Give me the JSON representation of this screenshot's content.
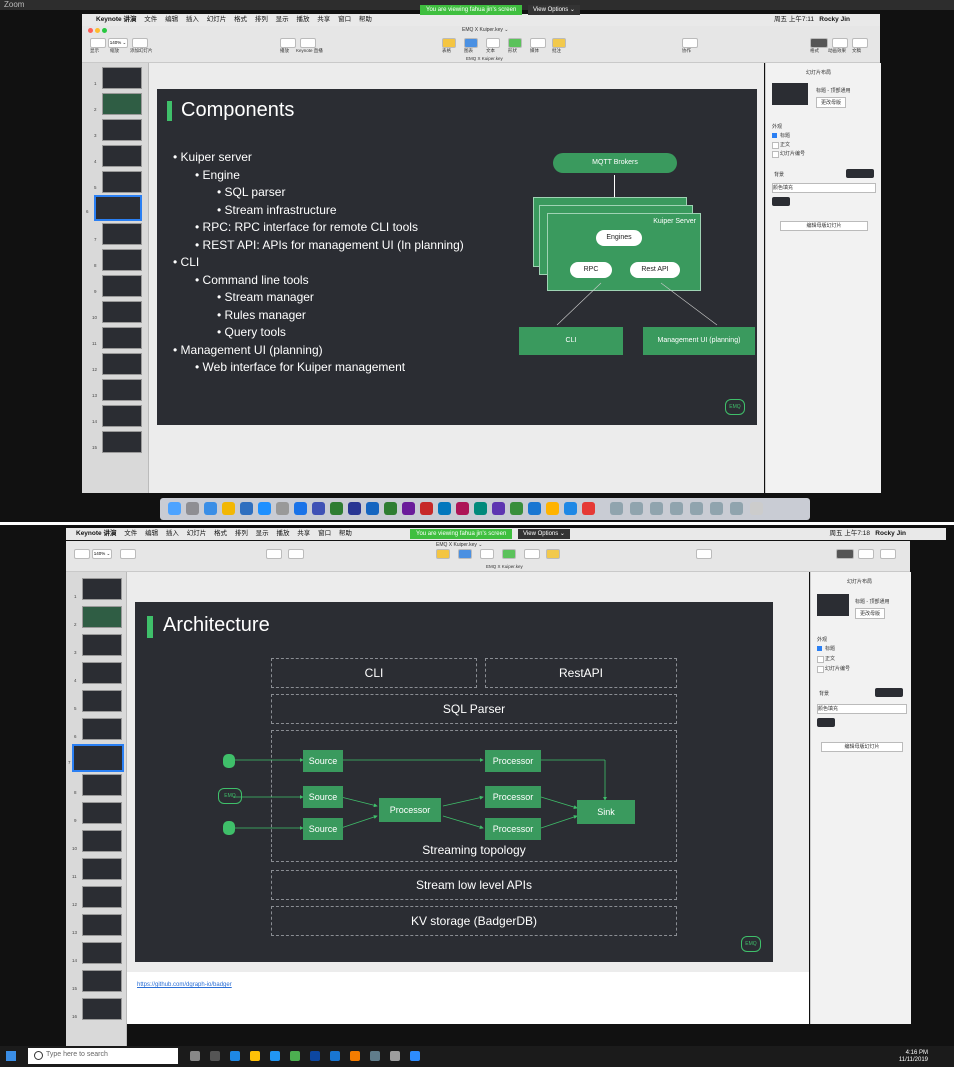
{
  "zoom": {
    "title": "Zoom"
  },
  "top": {
    "app_menu": [
      "Keynote 讲演",
      "文件",
      "编辑",
      "插入",
      "幻灯片",
      "格式",
      "排列",
      "显示",
      "播放",
      "共享",
      "窗口",
      "帮助"
    ],
    "banner": "You are viewing fahua jin's screen",
    "view_options": "View Options ⌄",
    "clock": "周五 上午7:11",
    "user": "Rocky Jin",
    "doc_title": "EMQ X Kuiper.key ⌄",
    "doc_subtitle": "EMQ X Kuiper.key",
    "zoom_level": "140% ⌄",
    "toolbar_labels": [
      "显示",
      "缩放",
      "添加幻灯片",
      "播放",
      "Keynote 直播",
      "表格",
      "图表",
      "文本",
      "形状",
      "媒体",
      "批注",
      "协作",
      "格式",
      "动画效果",
      "文稿"
    ],
    "slide": {
      "title": "Components",
      "bullets": [
        {
          "level": 1,
          "text": "Kuiper server"
        },
        {
          "level": 2,
          "text": "Engine"
        },
        {
          "level": 3,
          "text": "SQL parser"
        },
        {
          "level": 3,
          "text": "Stream infrastructure"
        },
        {
          "level": 2,
          "text": "RPC: RPC interface for remote CLI tools"
        },
        {
          "level": 2,
          "text": "REST API: APIs for management UI (In planning)"
        },
        {
          "level": 1,
          "text": "CLI"
        },
        {
          "level": 2,
          "text": "Command line tools"
        },
        {
          "level": 3,
          "text": "Stream manager"
        },
        {
          "level": 3,
          "text": "Rules manager"
        },
        {
          "level": 3,
          "text": "Query tools"
        },
        {
          "level": 1,
          "text": "Management UI (planning)"
        },
        {
          "level": 2,
          "text": "Web interface for Kuiper management"
        }
      ],
      "diagram": {
        "mqtt": "MQTT Brokers",
        "server": "Kuiper Server",
        "engines": "Engines",
        "rpc": "RPC",
        "rest": "Rest API",
        "cli": "CLI",
        "mgmt": "Management UI (planning)"
      },
      "logo": "EMQ"
    },
    "inspector": {
      "header": "幻灯片布局",
      "master": "标题 - 顶部通用",
      "change_master": "更改母版",
      "appearance": "外观",
      "opt_title": "标题",
      "opt_body": "正文",
      "opt_number": "幻灯片编号",
      "background": "背景",
      "fill": "颜色填充",
      "edit_master": "编辑母版幻灯片"
    },
    "thumb_numbers": [
      "1",
      "2",
      "3",
      "4",
      "5",
      "6",
      "7",
      "8",
      "9",
      "10",
      "11",
      "12",
      "13",
      "14",
      "15"
    ]
  },
  "bottom": {
    "app_menu": [
      "Keynote 讲演",
      "文件",
      "编辑",
      "插入",
      "幻灯片",
      "格式",
      "排列",
      "显示",
      "播放",
      "共享",
      "窗口",
      "帮助"
    ],
    "banner": "You are viewing fahua jin's screen",
    "view_options": "View Options ⌄",
    "clock": "周五 上午7:18",
    "user": "Rocky Jin",
    "doc_title": "EMQ X Kuiper.key ⌄",
    "doc_subtitle": "EMQ X Kuiper.key",
    "zoom_level": "140% ⌄",
    "slide": {
      "title": "Architecture",
      "cli": "CLI",
      "restapi": "RestAPI",
      "sqlparser": "SQL Parser",
      "source1": "Source",
      "source2": "Source",
      "source3": "Source",
      "processor_mid": "Processor",
      "processor_top": "Processor",
      "processor_2": "Processor",
      "processor_3": "Processor",
      "sink": "Sink",
      "topology": "Streaming topology",
      "lowlevel": "Stream low level APIs",
      "kv": "KV storage (BadgerDB)",
      "emq_label": "EMQ",
      "logo": "EMQ"
    },
    "notes_link": "https://github.com/dgraph-io/badger",
    "inspector": {
      "header": "幻灯片布局",
      "master": "标题 - 顶部通用",
      "change_master": "更改母版",
      "appearance": "外观",
      "opt_title": "标题",
      "opt_body": "正文",
      "opt_number": "幻灯片编号",
      "background": "背景",
      "fill": "颜色填充",
      "edit_master": "编辑母版幻灯片"
    },
    "thumb_numbers": [
      "1",
      "2",
      "3",
      "4",
      "5",
      "6",
      "7",
      "8",
      "9",
      "10",
      "11",
      "12",
      "13",
      "14",
      "15",
      "16"
    ],
    "taskbar": {
      "search_placeholder": "Type here to search",
      "time": "4:16 PM",
      "date": "11/11/2019"
    }
  }
}
